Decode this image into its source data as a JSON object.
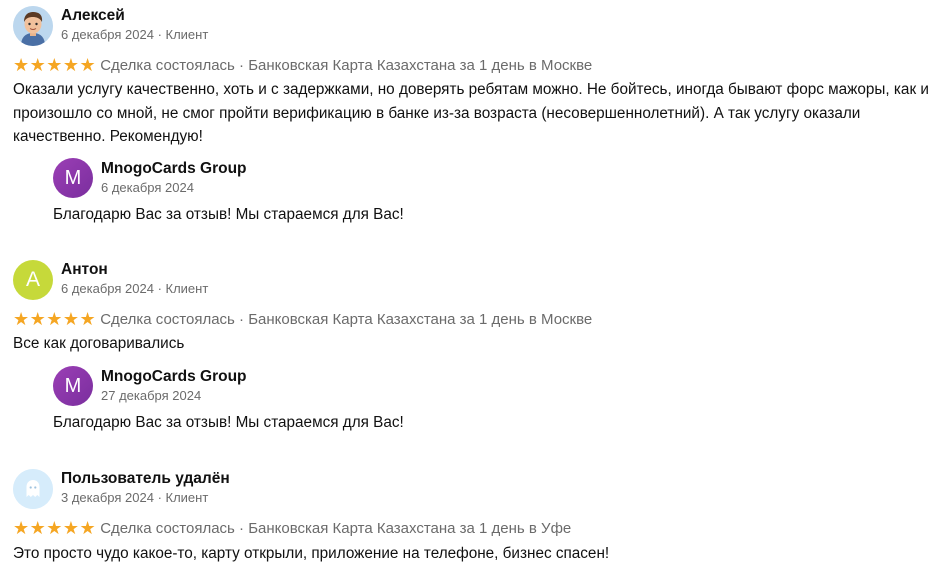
{
  "reviews": [
    {
      "author": "Алексей",
      "meta": "6 декабря 2024 · Клиент",
      "stars": "★★★★★",
      "deal": "Сделка состоялась · Банковская Карта Казахстана за 1 день в Москве",
      "text": "Оказали услугу качественно, хоть и с задержками, но доверять ребятам можно. Не бойтесь, иногда бывают форс мажоры, как и произошло со мной, не смог пройти верификацию в банке из-за возраста (несовершеннолетний). А так услугу оказали качественно. Рекомендую!",
      "avatar_icon": "cartoon-person-avatar",
      "reply": {
        "avatar_letter": "M",
        "author": "MnogoCards Group",
        "date": "6 декабря 2024",
        "text": "Благодарю Вас за отзыв! Мы стараемся для Вас!"
      }
    },
    {
      "author": "Антон",
      "meta": "6 декабря 2024 · Клиент",
      "stars": "★★★★★",
      "deal": "Сделка состоялась · Банковская Карта Казахстана за 1 день в Москве",
      "text": "Все как договаривались",
      "avatar_letter": "А",
      "avatar_color": "#c6d93a",
      "reply": {
        "avatar_letter": "M",
        "author": "MnogoCards Group",
        "date": "27 декабря 2024",
        "text": "Благодарю Вас за отзыв! Мы стараемся для Вас!"
      }
    },
    {
      "author": "Пользователь удалён",
      "meta": "3 декабря 2024 · Клиент",
      "stars": "★★★★★",
      "deal": "Сделка состоялась · Банковская Карта Казахстана за 1 день в Уфе",
      "text": "Это просто чудо какое-то, карту открыли, приложение на телефоне, бизнес спасен!",
      "avatar_icon": "ghost-icon",
      "avatar_color": "#d6ecfb"
    }
  ],
  "colors": {
    "star": "#f5a623",
    "muted": "#6b6b6b",
    "reply_avatar": "#8e3aa8"
  }
}
